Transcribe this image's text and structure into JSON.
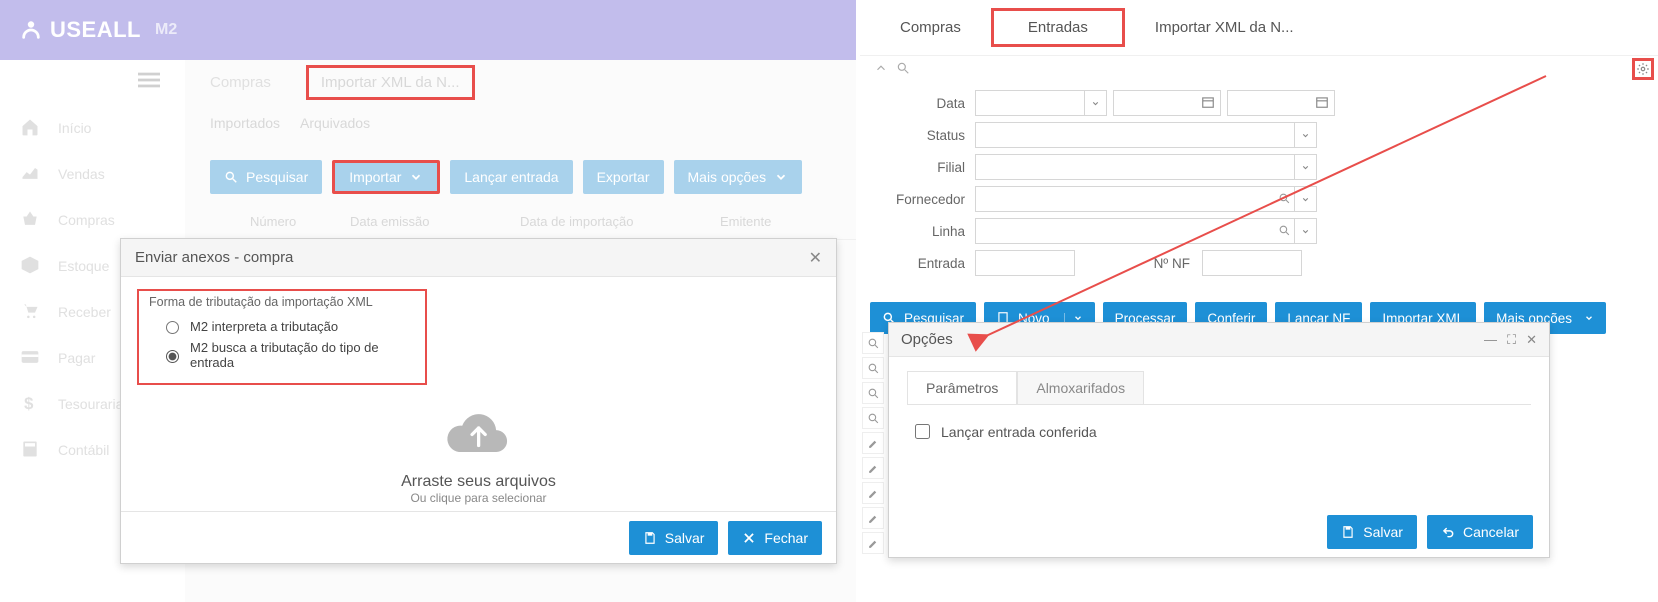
{
  "brand": {
    "name": "USEALL",
    "sub": "M2"
  },
  "sidebar": {
    "items": [
      {
        "label": "Início"
      },
      {
        "label": "Vendas"
      },
      {
        "label": "Compras"
      },
      {
        "label": "Estoque"
      },
      {
        "label": "Receber"
      },
      {
        "label": "Pagar"
      },
      {
        "label": "Tesouraria"
      },
      {
        "label": "Contábil"
      }
    ]
  },
  "left": {
    "breadcrumb": {
      "compras": "Compras",
      "import": "Importar XML da N..."
    },
    "tabs": {
      "importados": "Importados",
      "arquivados": "Arquivados"
    },
    "toolbar": {
      "pesquisar": "Pesquisar",
      "importar": "Importar",
      "lancar": "Lançar entrada",
      "exportar": "Exportar",
      "mais": "Mais opções"
    },
    "grid": {
      "col_numero": "Número",
      "col_emissao": "Data emissão",
      "col_import": "Data de importação",
      "col_emit": "Emitente"
    }
  },
  "modal": {
    "title": "Enviar anexos - compra",
    "tribut_title": "Forma de tributação da importação XML",
    "opt1": "M2 interpreta a tributação",
    "opt2": "M2 busca a tributação do tipo de entrada",
    "upload_t1": "Arraste seus arquivos",
    "upload_t2": "Ou clique para selecionar",
    "save": "Salvar",
    "close": "Fechar"
  },
  "right": {
    "breadcrumb": {
      "compras": "Compras",
      "entradas": "Entradas",
      "import": "Importar XML da N..."
    },
    "filters": {
      "data": "Data",
      "status": "Status",
      "filial": "Filial",
      "fornecedor": "Fornecedor",
      "linha": "Linha",
      "entrada": "Entrada",
      "nf": "Nº NF"
    },
    "toolbar": {
      "pesquisar": "Pesquisar",
      "novo": "Novo",
      "processar": "Processar",
      "conferir": "Conferir",
      "lancar_nf": "Lançar NF",
      "importar_xml": "Importar XML",
      "mais": "Mais opções"
    }
  },
  "rmodal": {
    "title": "Opções",
    "tab_param": "Parâmetros",
    "tab_almox": "Almoxarifados",
    "chk": "Lançar entrada conferida",
    "save": "Salvar",
    "cancel": "Cancelar"
  }
}
